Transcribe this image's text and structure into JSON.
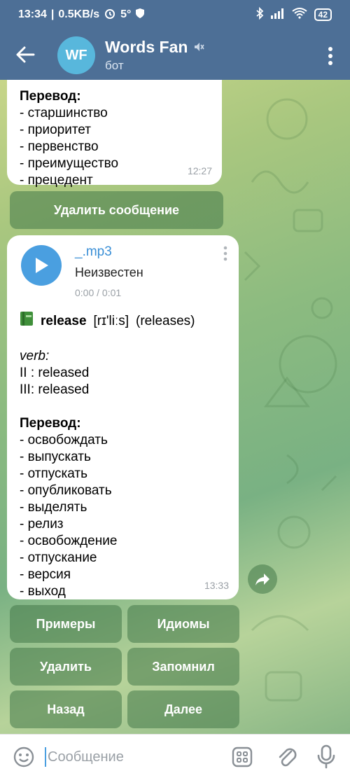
{
  "status_bar": {
    "time": "13:34",
    "net_speed": "0.5KB/s",
    "temperature": "5°",
    "battery": "42"
  },
  "header": {
    "avatar_initials": "WF",
    "title": "Words Fan",
    "subtitle": "бот"
  },
  "messages": [
    {
      "id": "msg1",
      "heading": "Перевод:",
      "lines": [
        "- старшинство",
        "- приоритет",
        "- первенство",
        "- преимущество",
        "- прецедент"
      ],
      "time": "12:27"
    },
    {
      "id": "msg2",
      "audio": {
        "file_name": "_.mp3",
        "artist": "Неизвестен",
        "duration": "0:00 / 0:01"
      },
      "word": "release",
      "transcription": "[rɪ'liːs]",
      "plural": "(releases)",
      "pos": "verb:",
      "forms": [
        "II : released",
        "III: released"
      ],
      "heading": "Перевод:",
      "lines": [
        "- освобождать",
        "- выпускать",
        "- отпускать",
        "- опубликовать",
        "- выделять",
        "- релиз",
        "- освобождение",
        "- отпускание",
        "- версия",
        "- выход"
      ],
      "time": "13:33"
    }
  ],
  "keyboard": {
    "delete_message": "Удалить сообщение",
    "examples": "Примеры",
    "idioms": "Идиомы",
    "delete": "Удалить",
    "remembered": "Запомнил",
    "back": "Назад",
    "next": "Далее"
  },
  "input": {
    "placeholder": "Сообщение"
  },
  "colors": {
    "header": "#4d6f96",
    "avatar": "#58b7dc",
    "link": "#3a8fd6",
    "keyboard_button": "#447848"
  }
}
